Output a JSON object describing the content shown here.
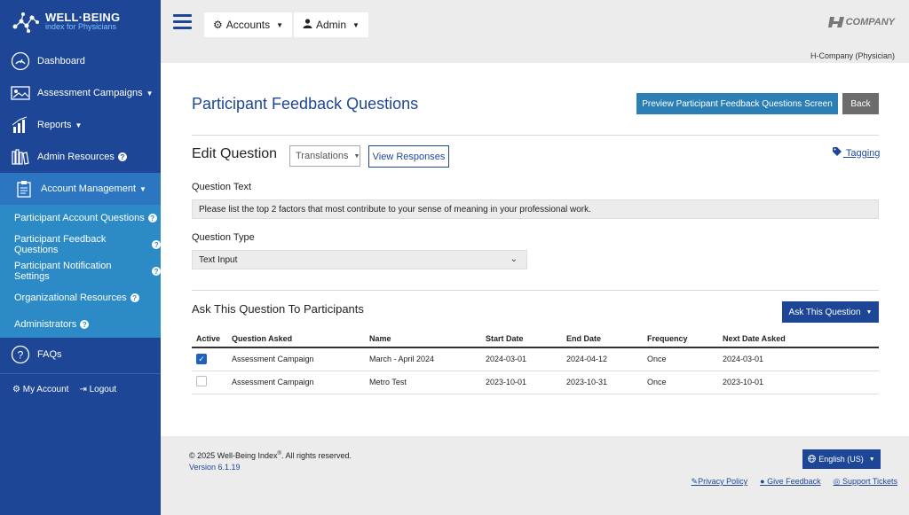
{
  "brand": {
    "title": "WELL·BEING",
    "subtitle": "index for Physicians"
  },
  "sidebar": {
    "items": [
      {
        "label": "Dashboard"
      },
      {
        "label": "Assessment Campaigns"
      },
      {
        "label": "Reports"
      },
      {
        "label": "Admin Resources"
      },
      {
        "label": "Account Management"
      }
    ],
    "subitems": [
      {
        "label": "Participant Account Questions"
      },
      {
        "label": "Participant Feedback Questions"
      },
      {
        "label": "Participant Notification Settings"
      },
      {
        "label": "Organizational Resources"
      },
      {
        "label": "Administrators"
      }
    ],
    "faq": "FAQs",
    "my_account": "My Account",
    "logout": "Logout",
    "help_glyph": "?"
  },
  "topbar": {
    "accounts_label": "Accounts",
    "admin_label": "Admin",
    "company_label": "COMPANY",
    "org_name": "H-Company (Physician)"
  },
  "page": {
    "title": "Participant Feedback Questions",
    "preview_button": "Preview Participant Feedback Questions Screen",
    "back_button": "Back",
    "edit_title": "Edit Question",
    "translations_label": "Translations",
    "view_responses_label": "View Responses",
    "tagging_label": "Tagging",
    "question_text_label": "Question Text",
    "question_text_value": "Please list the top 2 factors that most contribute to your sense of meaning in your professional work.",
    "question_type_label": "Question Type",
    "question_type_value": "Text Input",
    "ask_section_title": "Ask This Question To Participants",
    "ask_button": "Ask This Question"
  },
  "table": {
    "headers": [
      "Active",
      "Question Asked",
      "Name",
      "Start Date",
      "End Date",
      "Frequency",
      "Next Date Asked"
    ],
    "rows": [
      {
        "active": true,
        "question_asked": "Assessment Campaign",
        "name": "March - April 2024",
        "start": "2024-03-01",
        "end": "2024-04-12",
        "frequency": "Once",
        "next": "2024-03-01"
      },
      {
        "active": false,
        "question_asked": "Assessment Campaign",
        "name": "Metro Test",
        "start": "2023-10-01",
        "end": "2023-10-31",
        "frequency": "Once",
        "next": "2023-10-01"
      }
    ]
  },
  "footer": {
    "copyright_pre": "© 2025 Well-Being Index",
    "copyright_reg": "®",
    "copyright_post": ". All rights reserved.",
    "version": "Version 6.1.19",
    "language": "English (US)",
    "links": [
      "Privacy Policy",
      "Give Feedback",
      "Support Tickets"
    ]
  },
  "colors": {
    "primary": "#1d4796",
    "sidebar_sub": "#2c8ac6",
    "preview_btn": "#2b7fb5",
    "back_btn": "#6c6c6c"
  }
}
